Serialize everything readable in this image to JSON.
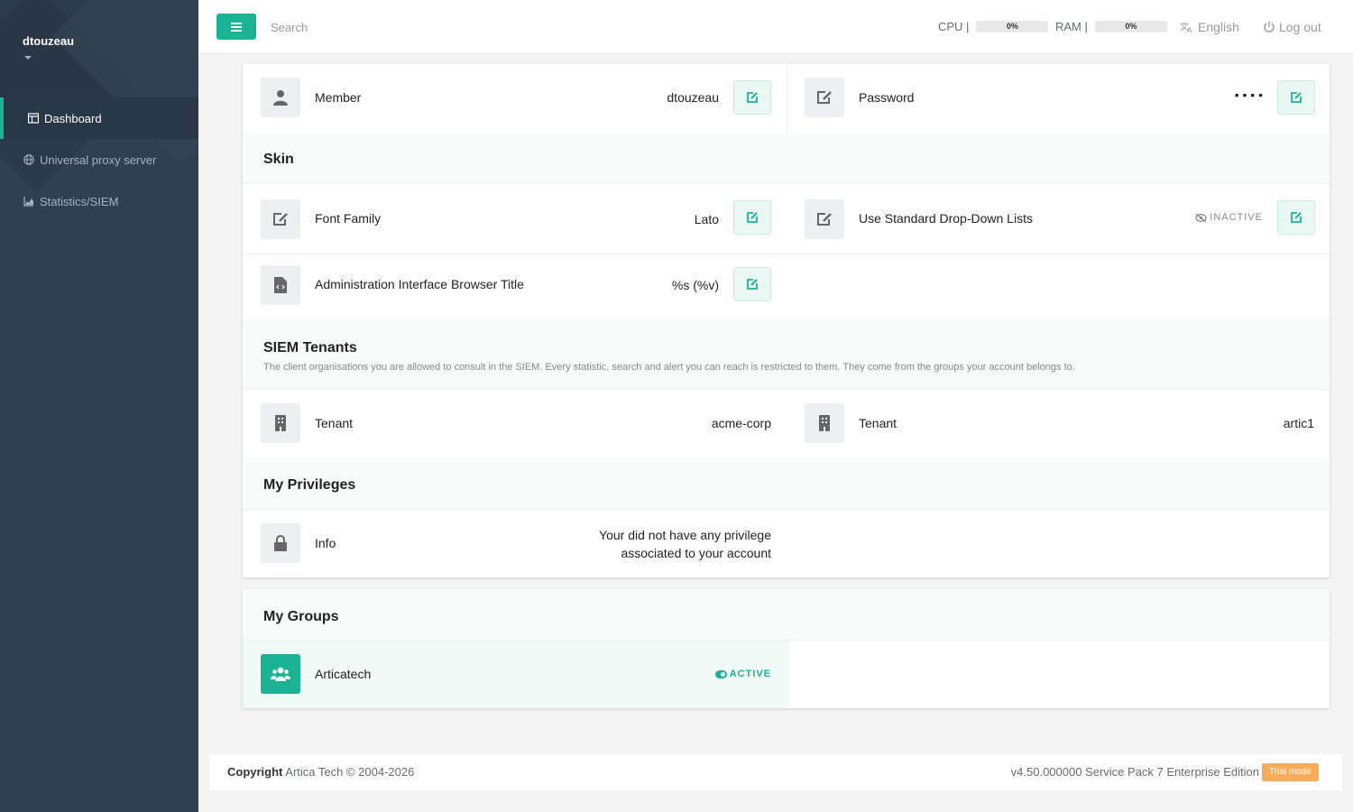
{
  "sidebar": {
    "username": "dtouzeau",
    "items": [
      {
        "label": "Dashboard"
      },
      {
        "label": "Universal proxy server"
      },
      {
        "label": "Statistics/SIEM"
      }
    ]
  },
  "topbar": {
    "search_placeholder": "Search",
    "cpu_label": "CPU |",
    "cpu_value": "0%",
    "ram_label": "RAM |",
    "ram_value": "0%",
    "language": "English",
    "logout": "Log out"
  },
  "account": {
    "member_label": "Member",
    "member_value": "dtouzeau",
    "password_label": "Password",
    "password_value": "• • • •"
  },
  "skin": {
    "title": "Skin",
    "font_family_label": "Font Family",
    "font_family_value": "Lato",
    "dropdown_label": "Use Standard Drop-Down Lists",
    "dropdown_status": "INACTIVE",
    "browser_title_label": "Administration Interface Browser Title",
    "browser_title_value": "%s (%v)"
  },
  "siem": {
    "title": "SIEM Tenants",
    "description": "The client organisations you are allowed to consult in the SIEM. Every statistic, search and alert you can reach is restricted to them. They come from the groups your account belongs to.",
    "tenants": [
      {
        "label": "Tenant",
        "value": "acme-corp"
      },
      {
        "label": "Tenant",
        "value": "artic1"
      }
    ]
  },
  "privileges": {
    "title": "My Privileges",
    "info_label": "Info",
    "info_line1": "Your did not have any privilege",
    "info_line2": "associated to your account"
  },
  "groups": {
    "title": "My Groups",
    "items": [
      {
        "name": "Articatech",
        "status": "ACTIVE"
      }
    ]
  },
  "footer": {
    "copyright_bold": "Copyright",
    "copyright_text": "Artica Tech © 2004-2026",
    "version": "v4.50.000000 Service Pack 7 Enterprise Edition",
    "trial": "Trial mode"
  },
  "colors": {
    "accent": "#1ab394",
    "sidebar": "#2f4050",
    "trial": "#f8ac59"
  }
}
